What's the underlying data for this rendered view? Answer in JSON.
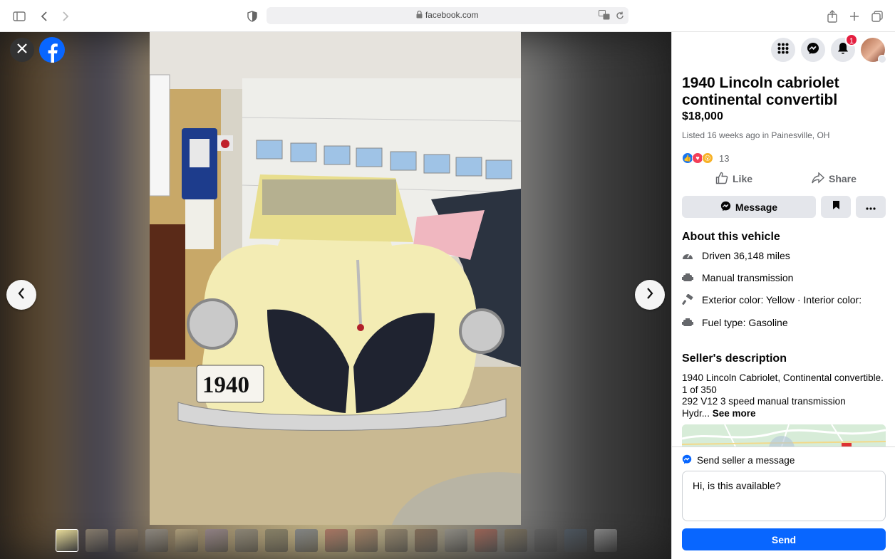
{
  "browser": {
    "url": "facebook.com",
    "icons": [
      "sidebar-icon",
      "back-icon",
      "forward-icon",
      "privacy-shield-icon",
      "lock-icon",
      "translate-icon",
      "reload-icon",
      "share-icon",
      "new-tab-icon",
      "tabs-overview-icon"
    ]
  },
  "viewer": {
    "icons": [
      "close-icon",
      "facebook-logo",
      "chevron-left-icon",
      "chevron-right-icon"
    ],
    "thumbnail_count": 19,
    "active_thumbnail": 1
  },
  "header": {
    "notification_count": "1",
    "icons": [
      "menu-grid-icon",
      "messenger-icon",
      "bell-icon"
    ]
  },
  "listing": {
    "title": "1940 Lincoln cabriolet continental convertibl",
    "price": "$18,000",
    "listed": "Listed 16 weeks ago in Painesville, OH",
    "reaction_count": "13",
    "like_label": "Like",
    "share_label": "Share",
    "message_label": "Message"
  },
  "about": {
    "heading": "About this vehicle",
    "specs": [
      {
        "icon": "speedometer-icon",
        "text": "Driven 36,148 miles"
      },
      {
        "icon": "transmission-icon",
        "text": "Manual transmission"
      },
      {
        "icon": "paint-icon",
        "text": "Exterior color: Yellow · Interior color:"
      },
      {
        "icon": "fuel-icon",
        "text": "Fuel type: Gasoline"
      }
    ]
  },
  "seller": {
    "heading": "Seller's description",
    "lines": [
      "1940 Lincoln Cabriolet, Continental convertible.",
      "1 of 350",
      "292 V12 3 speed manual transmission"
    ],
    "truncated": "Hydr...",
    "see_more": "See more"
  },
  "send": {
    "label": "Send seller a message",
    "value": "Hi, is this available?",
    "button": "Send"
  },
  "colors": {
    "accent": "#0866ff",
    "badge": "#e41e3f",
    "car": "#f3ecb4"
  }
}
